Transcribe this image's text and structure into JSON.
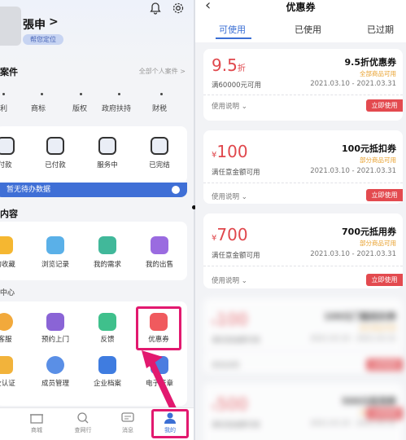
{
  "left": {
    "username": "張申",
    "member_badge": "帮您定位",
    "section_cases": {
      "title": "案件",
      "link": "全部个人案件 >"
    },
    "categories": [
      "利",
      "商标",
      "版权",
      "政府扶持",
      "财税"
    ],
    "orders": [
      "付款",
      "已付款",
      "服务中",
      "已完结"
    ],
    "banner_text": "暂无待办数据",
    "section_content": "内容",
    "content_items": [
      "的收藏",
      "浏览记录",
      "我的需求",
      "我的出售"
    ],
    "section_center": "中心",
    "center_row1": [
      "客服",
      "预约上门",
      "反馈",
      "优惠券"
    ],
    "center_row2": [
      "业认证",
      "成员管理",
      "企业档案",
      "电子签章"
    ],
    "tabbar": [
      "商城",
      "查网行",
      "消息",
      "我的"
    ]
  },
  "right": {
    "title": "优惠券",
    "tabs": [
      "可使用",
      "已使用",
      "已过期"
    ],
    "coupons": [
      {
        "amount": "9.5",
        "unit": "折",
        "prefix": "",
        "condition": "满60000元可用",
        "title": "9.5折优惠券",
        "scope": "全部商品可用",
        "date": "2021.03.10 - 2021.03.31",
        "usage": "使用说明",
        "button": "立即使用"
      },
      {
        "amount": "100",
        "unit": "",
        "prefix": "¥",
        "condition": "满任意金额可用",
        "title": "100元抵扣券",
        "scope": "部分商品可用",
        "date": "2021.03.10 - 2021.03.31",
        "usage": "使用说明",
        "button": "立即使用"
      },
      {
        "amount": "700",
        "unit": "",
        "prefix": "¥",
        "condition": "满任意金额可用",
        "title": "700元抵用券",
        "scope": "部分商品可用",
        "date": "2021.03.10 - 2021.03.31",
        "usage": "使用说明",
        "button": "立即使用"
      },
      {
        "amount": "100",
        "unit": "",
        "prefix": "¥",
        "condition": "满任意金额可用",
        "title": "100元门槛抵扣券",
        "scope": "部分商品可用",
        "date": "2021.03.10 - 2021.03.31",
        "usage": "使用说明",
        "button": "立即使用"
      },
      {
        "amount": "500",
        "unit": "",
        "prefix": "¥",
        "condition": "满任意金额可用",
        "title": "500元抵用券",
        "scope": "部分商品可用",
        "date": "2021.03.10 - 2021.03.31",
        "usage": "使用说明",
        "button": "立即使用"
      }
    ]
  },
  "colors": {
    "accent_blue": "#3b6fd4",
    "coupon_red": "#e0474c",
    "highlight_pink": "#e2196f",
    "scope_orange": "#e8a02c"
  }
}
